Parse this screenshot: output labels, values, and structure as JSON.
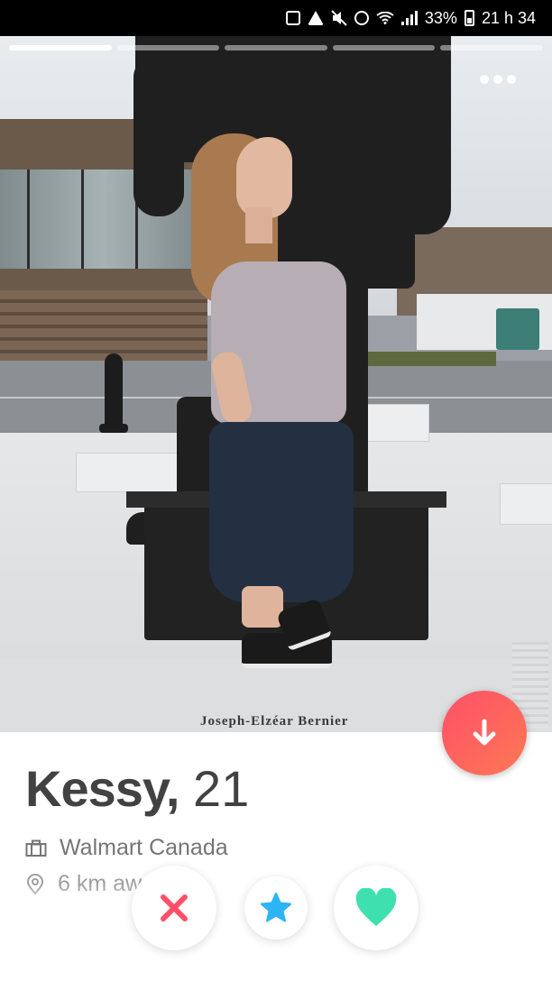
{
  "status_bar": {
    "battery_percent": "33%",
    "time": "21 h 34",
    "icons": [
      "photo-notification-icon",
      "warning-icon",
      "mute-icon",
      "alarm-icon",
      "wifi-icon",
      "signal-icon",
      "battery-icon"
    ]
  },
  "photo": {
    "photo_count": 5,
    "active_photo_index": 0,
    "plaque_text": "Joseph-Elzéar Bernier",
    "more_icon": "more-dots-icon"
  },
  "profile": {
    "name": "Kessy,",
    "age": "21",
    "job": "Walmart Canada",
    "job_icon": "briefcase-icon",
    "distance": "6 km away",
    "distance_icon": "location-pin-icon"
  },
  "actions": {
    "info_button_icon": "arrow-down-icon",
    "nope_icon": "x-icon",
    "superlike_icon": "star-icon",
    "like_icon": "heart-icon"
  },
  "colors": {
    "brand_gradient_start": "#fd5068",
    "brand_gradient_end": "#ff7854",
    "nope": "#fd5068",
    "superlike": "#2db4f5",
    "like": "#3fe0b0",
    "text_primary": "#424242",
    "text_secondary": "#757575"
  }
}
